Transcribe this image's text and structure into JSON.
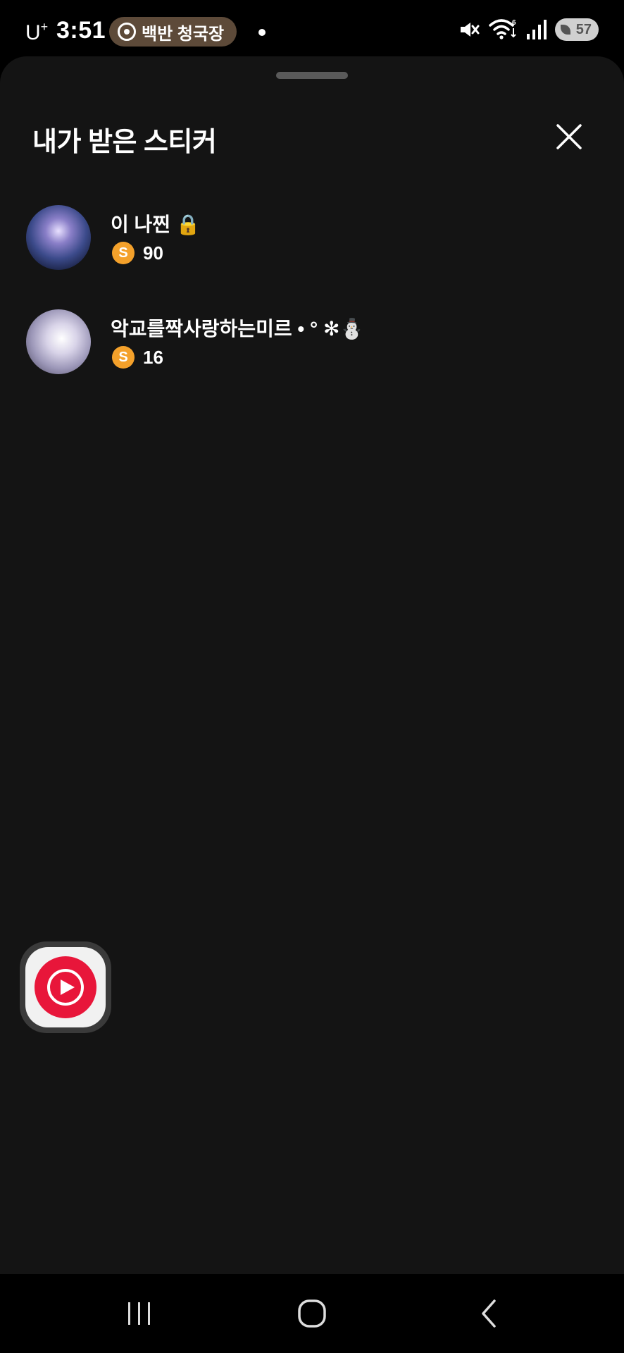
{
  "status_bar": {
    "carrier": "U",
    "carrier_sup": "+",
    "time": "3:51",
    "media_label": "백반 청국장",
    "battery": "57"
  },
  "sheet": {
    "title": "내가 받은 스티커",
    "items": [
      {
        "name": "이   나찐 🔒",
        "coins": "90",
        "coin_symbol": "S"
      },
      {
        "name": "악교를짝사랑하는미르 • ° ✻⛄",
        "coins": "16",
        "coin_symbol": "S"
      }
    ]
  },
  "colors": {
    "sheet_bg": "#141414",
    "coin": "#f4a12b",
    "media_pill": "#5d4a39",
    "floating_app_red": "#e8163a"
  },
  "icons": {
    "close": "close-icon",
    "coin": "coin-icon",
    "floating_app": "youtube-music-icon",
    "nav_recents": "recents-icon",
    "nav_home": "home-icon",
    "nav_back": "back-icon"
  }
}
